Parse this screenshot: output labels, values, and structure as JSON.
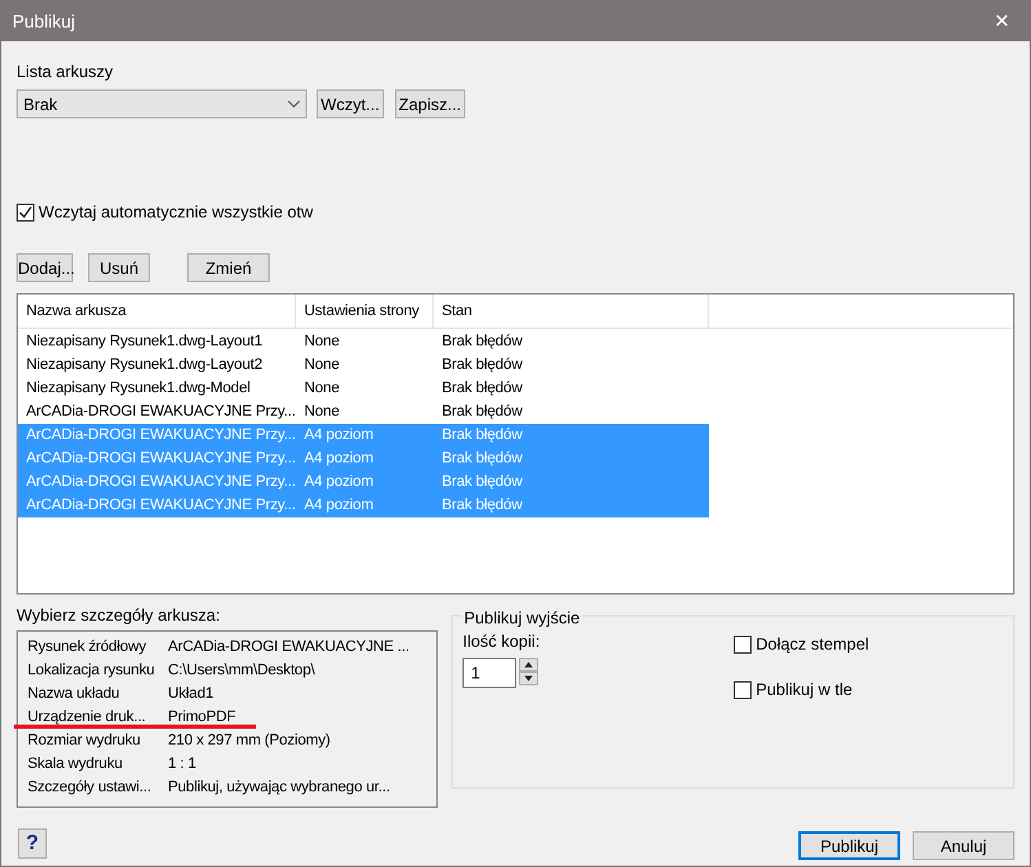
{
  "window": {
    "title": "Publikuj",
    "close": "✕"
  },
  "sheet_list": {
    "label": "Lista arkuszy",
    "value": "Brak",
    "buttons": [
      "Wczyt...",
      "Zapisz..."
    ]
  },
  "auto_load": {
    "label": "Wczytaj automatycznie wszystkie otw",
    "checked": true
  },
  "list_buttons": [
    "Dodaj...",
    "Usuń",
    "Zmień"
  ],
  "table": {
    "columns": [
      "Nazwa arkusza",
      "Ustawienia strony",
      "Stan"
    ],
    "rows": [
      {
        "cells": [
          "Niezapisany Rysunek1.dwg-Layout1",
          "None",
          "Brak błędów"
        ],
        "selected": false
      },
      {
        "cells": [
          "Niezapisany Rysunek1.dwg-Layout2",
          "None",
          "Brak błędów"
        ],
        "selected": false
      },
      {
        "cells": [
          "Niezapisany Rysunek1.dwg-Model",
          "None",
          "Brak błędów"
        ],
        "selected": false
      },
      {
        "cells": [
          "ArCADia-DROGI EWAKUACYJNE Przy...",
          "None",
          "Brak błędów"
        ],
        "selected": false
      },
      {
        "cells": [
          "ArCADia-DROGI EWAKUACYJNE Przy...",
          "A4 poziom",
          "Brak błędów"
        ],
        "selected": true
      },
      {
        "cells": [
          "ArCADia-DROGI EWAKUACYJNE Przy...",
          "A4 poziom",
          "Brak błędów"
        ],
        "selected": true
      },
      {
        "cells": [
          "ArCADia-DROGI EWAKUACYJNE Przy...",
          "A4 poziom",
          "Brak błędów"
        ],
        "selected": true
      },
      {
        "cells": [
          "ArCADia-DROGI EWAKUACYJNE Przy...",
          "A4 poziom",
          "Brak błędów"
        ],
        "selected": true
      }
    ]
  },
  "details": {
    "title": "Wybierz szczegóły arkusza:",
    "rows": [
      {
        "label": "Rysunek źródłowy",
        "value": "ArCADia-DROGI EWAKUACYJNE ..."
      },
      {
        "label": "Lokalizacja rysunku",
        "value": "C:\\Users\\mm\\Desktop\\"
      },
      {
        "label": "Nazwa układu",
        "value": "Układ1"
      },
      {
        "label": "Urządzenie druk...",
        "value": "PrimoPDF",
        "marked": true
      },
      {
        "label": "Rozmiar wydruku",
        "value": "210 x 297 mm (Poziomy)"
      },
      {
        "label": "Skala wydruku",
        "value": "1 : 1"
      },
      {
        "label": "Szczegóły ustawi...",
        "value": "Publikuj, używając wybranego ur..."
      }
    ]
  },
  "output": {
    "title": "Publikuj wyjście",
    "copies_label": "Ilość kopii:",
    "copies": "1",
    "options": [
      {
        "label": "Dołącz stempel",
        "checked": false
      },
      {
        "label": "Publikuj w tle",
        "checked": false
      }
    ]
  },
  "help": "?",
  "footer_buttons": [
    {
      "label": "Publikuj",
      "default": true
    },
    {
      "label": "Anuluj",
      "default": false
    }
  ]
}
